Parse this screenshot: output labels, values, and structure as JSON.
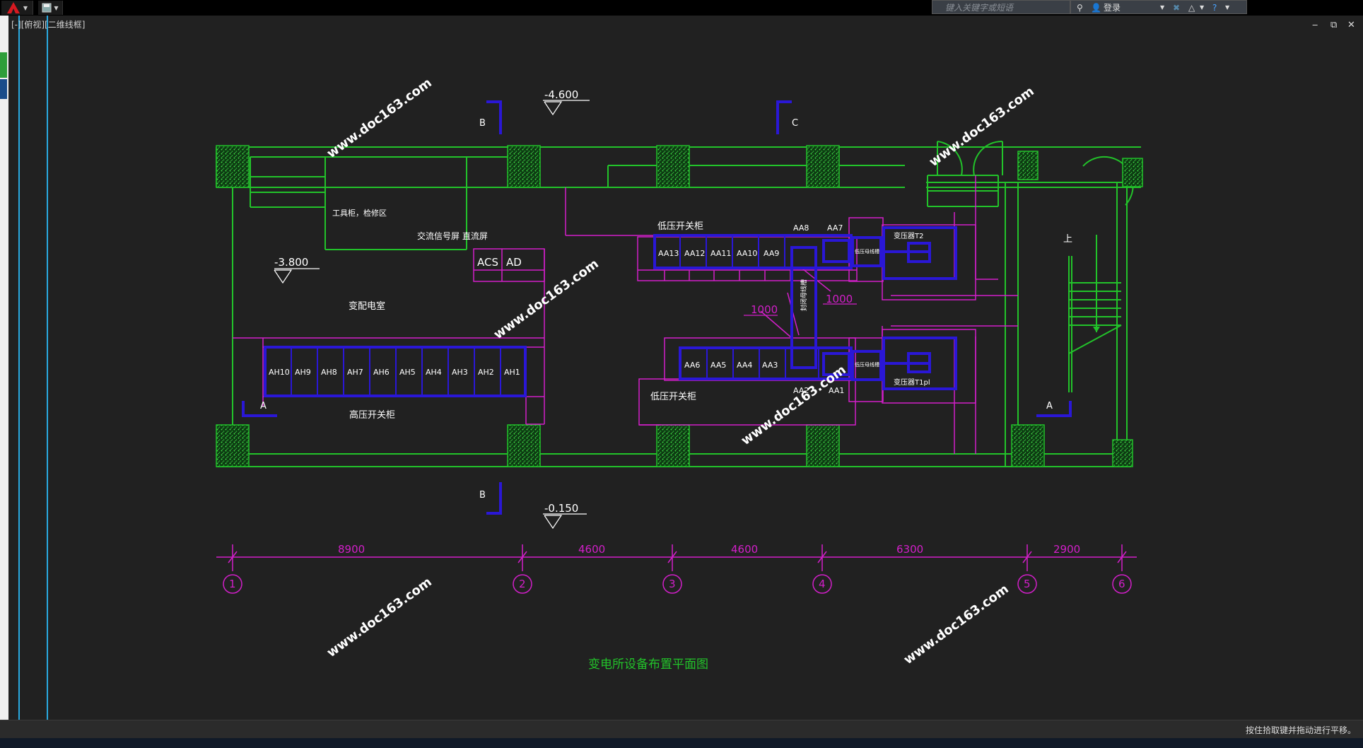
{
  "app": {
    "search_placeholder": "键入关键字或短语",
    "signin_label": "登录",
    "viewport_label": "[-][俯视][二维线框]",
    "status_text": "按住拾取键并拖动进行平移。",
    "window_controls": {
      "minimize": "‒",
      "restore": "⧉",
      "close": "✕"
    }
  },
  "drawing": {
    "title": "变电所设备布置平面图",
    "levels": {
      "top": "-4.600",
      "left": "-3.800",
      "bottom": "-0.150"
    },
    "sections": {
      "b_top": "B",
      "c_top": "C",
      "b_bottom": "B",
      "a_left": "A",
      "a_right": "A"
    },
    "rooms": {
      "tools": "工具柜，检修区",
      "signal": "交流信号屏  直流屏",
      "distribution_room": "变配电室",
      "hv_label": "高压开关柜",
      "lv_label_top": "低压开关柜",
      "lv_label_bottom": "低压开关柜",
      "stair_up": "上"
    },
    "panels": {
      "acs": "ACS",
      "ad": "AD"
    },
    "hv_cabinets": [
      "AH10",
      "AH9",
      "AH8",
      "AH7",
      "AH6",
      "AH5",
      "AH4",
      "AH3",
      "AH2",
      "AH1"
    ],
    "lv_top_cabinets": [
      "AA13",
      "AA12",
      "AA11",
      "AA10",
      "AA9"
    ],
    "lv_top_over": {
      "aa8": "AA8",
      "aa7": "AA7"
    },
    "lv_bottom_cabinets": [
      "AA6",
      "AA5",
      "AA4",
      "AA3"
    ],
    "lv_bottom_over": {
      "aa2": "AA2",
      "aa1": "AA1"
    },
    "transformers": {
      "t2": "变压器T2",
      "t1": "变压器T1pl",
      "busway_small_top": "低压母线槽",
      "busway_small_bottom": "低压母线槽",
      "vertical_busway": "封闭母线槽"
    },
    "busway_dims": {
      "left": "1000",
      "right": "1000"
    },
    "dimensions": [
      "8900",
      "4600",
      "4600",
      "6300",
      "2900"
    ],
    "axes": [
      "1",
      "2",
      "3",
      "4",
      "5",
      "6"
    ],
    "watermark": "www.doc163.com"
  },
  "colors": {
    "green": "#22c32a",
    "magenta": "#d21fc9",
    "blue": "#2a17d6",
    "cyan": "#29a9e0"
  }
}
